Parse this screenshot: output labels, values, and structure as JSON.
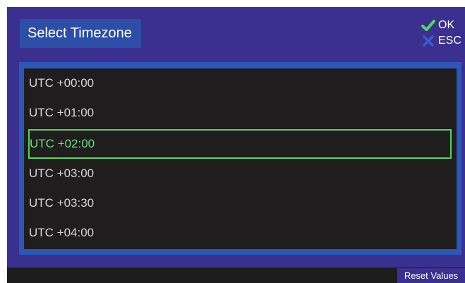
{
  "header": {
    "title": "Select Timezone"
  },
  "actions": {
    "ok_label": "OK",
    "esc_label": "ESC",
    "ok_color": "#4cd964",
    "esc_color": "#3b5bd0"
  },
  "timezones": [
    "UTC +00:00",
    "UTC +01:00",
    "UTC +02:00",
    "UTC +03:00",
    "UTC +03:30",
    "UTC +04:00"
  ],
  "selected_timezone": "UTC +02:00",
  "footer": {
    "reset_label": "Reset Values"
  },
  "colors": {
    "background": "#3b2f8f",
    "list_frame": "#2a57b8",
    "list_bg": "#1f1d1d",
    "selection": "#57d45a"
  }
}
